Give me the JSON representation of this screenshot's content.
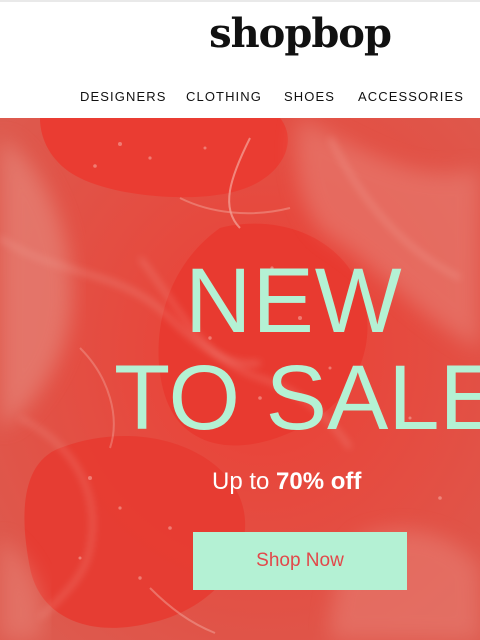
{
  "header": {
    "logo_text": "shopbop",
    "nav": [
      {
        "label": "DESIGNERS"
      },
      {
        "label": "CLOTHING"
      },
      {
        "label": "SHOES"
      },
      {
        "label": "ACCESSORIES"
      }
    ]
  },
  "hero": {
    "headline_line1": "NEW",
    "headline_line2": "TO SALE",
    "subline_prefix": "Up to ",
    "subline_highlight": "70% off",
    "cta_label": "Shop Now",
    "colors": {
      "background": "#e24a3d",
      "headline": "#b4f1d4",
      "cta_background": "#b4f1d4",
      "cta_text": "#e2484a"
    }
  }
}
